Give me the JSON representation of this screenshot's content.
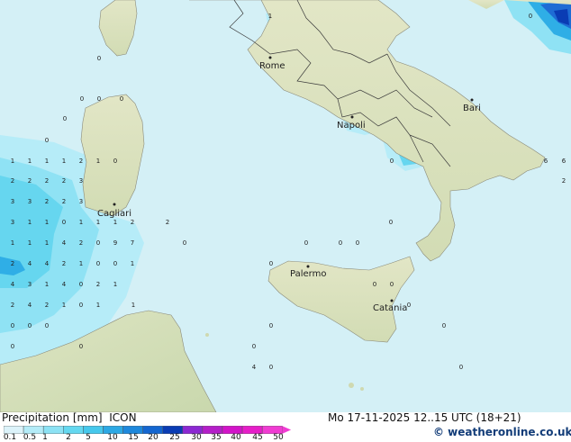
{
  "map": {
    "cities": [
      {
        "name": "Rome"
      },
      {
        "name": "Bari"
      },
      {
        "name": "Napoli"
      },
      {
        "name": "Cagliari"
      },
      {
        "name": "Palermo"
      },
      {
        "name": "Catania"
      }
    ],
    "precip_values": [
      "1",
      "0",
      "0",
      "0",
      "0",
      "0",
      "0",
      "1",
      "1",
      "1",
      "1",
      "2",
      "1",
      "0",
      "2",
      "2",
      "2",
      "2",
      "3",
      "3",
      "3",
      "2",
      "2",
      "3",
      "3",
      "1",
      "1",
      "0",
      "1",
      "1",
      "1",
      "2",
      "2",
      "1",
      "1",
      "1",
      "4",
      "2",
      "0",
      "9",
      "7",
      "2",
      "4",
      "4",
      "2",
      "1",
      "0",
      "0",
      "1",
      "4",
      "3",
      "1",
      "4",
      "0",
      "2",
      "1",
      "2",
      "4",
      "2",
      "1",
      "0",
      "1",
      "1",
      "0",
      "0",
      "0",
      "0",
      "0",
      "0",
      "0",
      "0",
      "0",
      "0",
      "0",
      "0",
      "0",
      "0",
      "0",
      "0",
      "0",
      "0",
      "0",
      "0",
      "4",
      "6",
      "6",
      "2",
      "0"
    ]
  },
  "footer": {
    "title": "Precipitation [mm]",
    "model": "ICON",
    "datetime": "Mo 17-11-2025 12..15 UTC (18+21)",
    "credit": "© weatheronline.co.uk"
  },
  "legend": {
    "ticks": [
      "0.1",
      "0.5",
      "1",
      "2",
      "5",
      "10",
      "15",
      "20",
      "25",
      "30",
      "35",
      "40",
      "45",
      "50"
    ],
    "colors": [
      "#dcf3fa",
      "#b4ecf8",
      "#8ce2f4",
      "#64d8f0",
      "#46c8ec",
      "#2ca8e4",
      "#1e88dc",
      "#1466d0",
      "#0a3cb4",
      "#8c28d2",
      "#b41ec8",
      "#d214c8",
      "#e61ec8",
      "#f03cd2"
    ]
  },
  "colors": {
    "sea": "#d4f0f6",
    "land": "#dfe6c4",
    "border": "#3c3c3c"
  }
}
